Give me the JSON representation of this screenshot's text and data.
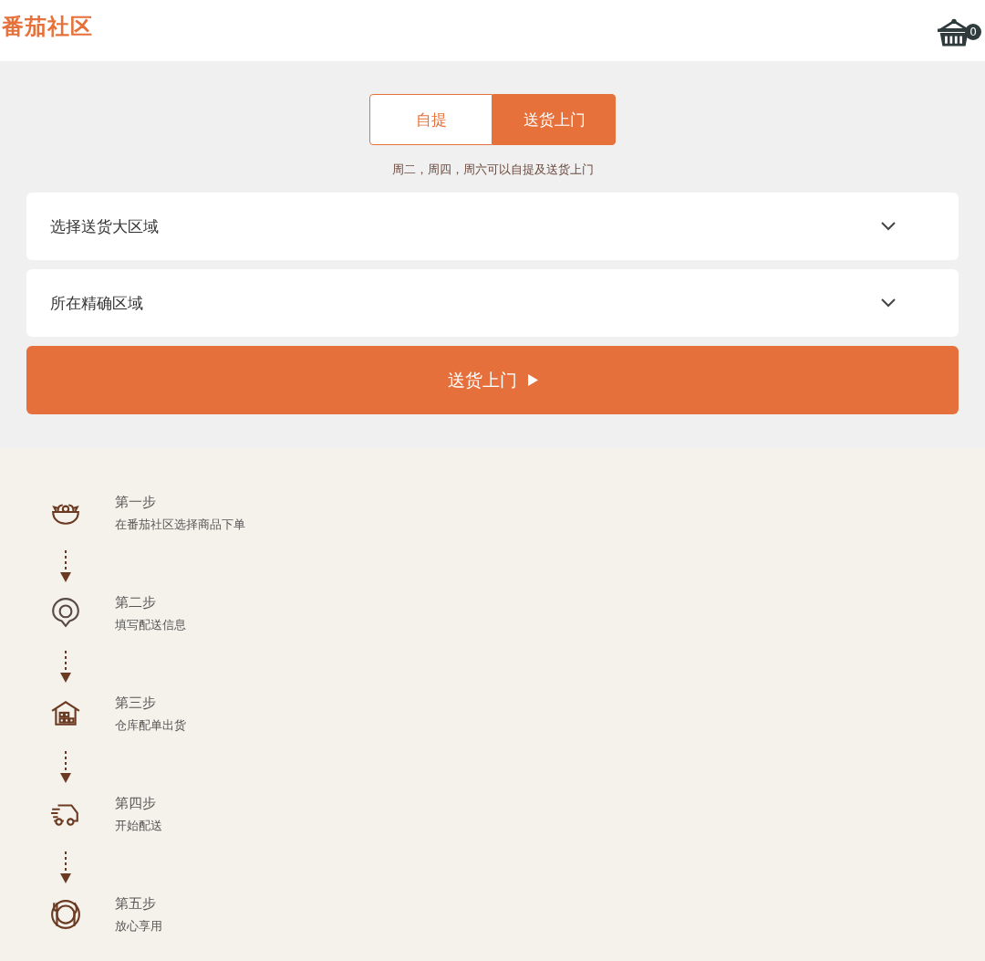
{
  "header": {
    "logo": "番茄社区",
    "cart_count": "0"
  },
  "mode_tabs": [
    {
      "label": "自提",
      "selected": false
    },
    {
      "label": "送货上门",
      "selected": true
    }
  ],
  "schedule_note": "周二，周四，周六可以自提及送货上门",
  "selects": [
    {
      "label": "选择送货大区域"
    },
    {
      "label": "所在精确区域"
    }
  ],
  "submit_button": "送货上门",
  "steps": [
    {
      "kind": "bowl",
      "title": "第一步",
      "text": "在番茄社区选择商品下单"
    },
    {
      "kind": "pin",
      "title": "第二步",
      "text": "填写配送信息"
    },
    {
      "kind": "warehouse",
      "title": "第三步",
      "text": "仓库配单出货"
    },
    {
      "kind": "truck",
      "title": "第四步",
      "text": "开始配送"
    },
    {
      "kind": "plate",
      "title": "第五步",
      "text": "放心享用"
    }
  ]
}
